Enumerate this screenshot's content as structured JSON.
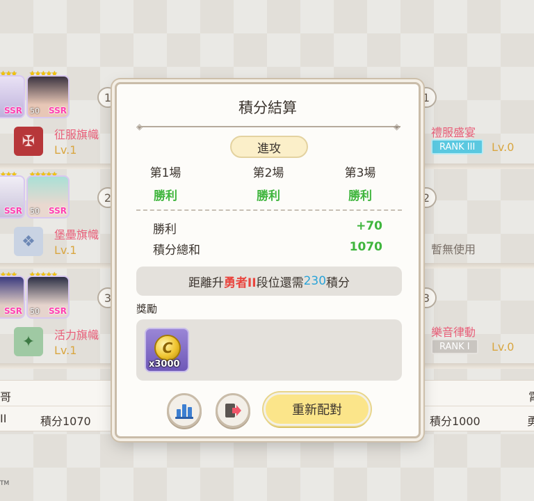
{
  "modal": {
    "title": "積分結算",
    "mode": "進攻",
    "matches": [
      {
        "label": "第1場",
        "result": "勝利"
      },
      {
        "label": "第2場",
        "result": "勝利"
      },
      {
        "label": "第3場",
        "result": "勝利"
      }
    ],
    "stats": [
      {
        "label": "勝利",
        "value": "+70"
      },
      {
        "label": "積分總和",
        "value": "1070"
      }
    ],
    "promotion": {
      "prefix": "距離升",
      "rank": "勇者II",
      "middle": "段位還需",
      "points": "230",
      "suffix": "積分"
    },
    "reward_label": "獎勵",
    "rewards": [
      {
        "icon": "coin-icon",
        "quantity": "x3000"
      }
    ],
    "buttons": {
      "requeue": "重新配對"
    }
  },
  "left_team": {
    "slots": [
      "1",
      "2",
      "3"
    ],
    "card_rarity": "SSR",
    "card_level": "50",
    "flags": [
      {
        "name": "征服旗幟",
        "level": "Lv.1"
      },
      {
        "name": "堡壘旗幟",
        "level": "Lv.1"
      },
      {
        "name": "活力旗幟",
        "level": "Lv.1"
      }
    ],
    "player_name": "哥",
    "rank_short": "II",
    "score": "積分1070"
  },
  "right_team": {
    "slots": [
      "1",
      "2",
      "3"
    ],
    "items": [
      {
        "name": "禮服盛宴",
        "rank": "RANK III",
        "level": "Lv.0"
      },
      {
        "name": "暫無使用"
      },
      {
        "name": "樂音律動",
        "rank": "RANK I",
        "level": "Lv.0"
      }
    ],
    "player_name": "霄",
    "rank_short": "勇",
    "score": "積分1000"
  },
  "footer": {
    "trademark": "TM"
  },
  "colors": {
    "win": "#3fb53d",
    "rank_red": "#e9453e",
    "points_blue": "#2aa3d8",
    "flag_pink": "#e8607a"
  }
}
